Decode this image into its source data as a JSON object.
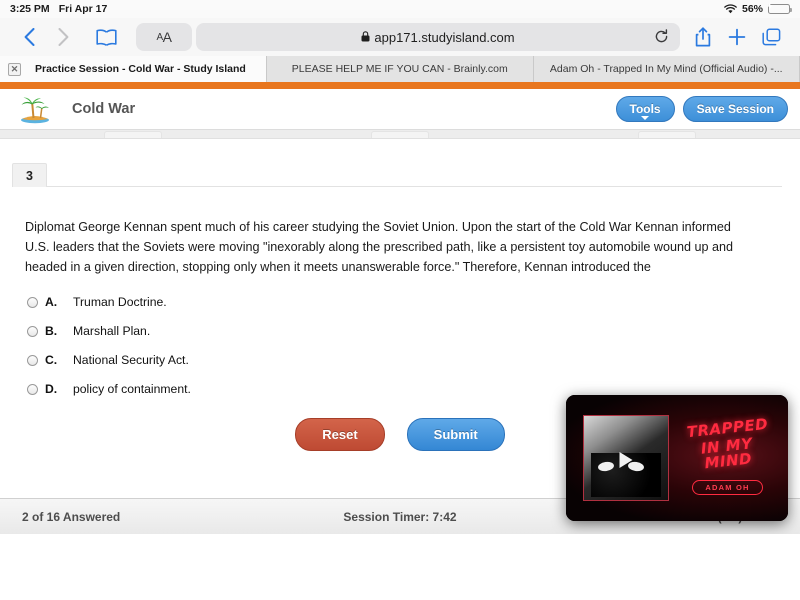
{
  "status_bar": {
    "time": "3:25 PM",
    "date": "Fri Apr 17",
    "battery_percent": "56%",
    "wifi_icon": "wifi-icon",
    "battery_icon": "battery-charging-icon"
  },
  "browser": {
    "back_icon": "chevron-left-icon",
    "forward_icon": "chevron-right-icon",
    "bookmarks_icon": "book-icon",
    "text_size_label_small": "A",
    "text_size_label_large": "A",
    "lock_icon": "lock-icon",
    "url": "app171.studyisland.com",
    "reload_icon": "reload-icon",
    "share_icon": "share-icon",
    "new_tab_icon": "plus-icon",
    "tabs_overview_icon": "tabs-icon",
    "tabs": [
      {
        "label": "Practice Session - Cold War - Study Island",
        "active": true,
        "close_icon": "close-icon"
      },
      {
        "label": "PLEASE HELP ME IF YOU CAN - Brainly.com",
        "active": false
      },
      {
        "label": "Adam Oh - Trapped In My Mind (Official Audio) -...",
        "active": false
      }
    ]
  },
  "site_header": {
    "logo_icon": "palm-island-logo",
    "title": "Cold War",
    "tools_button": "Tools",
    "save_session_button": "Save Session",
    "brand_color": "#e8761e",
    "button_color": "#3d8fd8"
  },
  "question": {
    "number": "3",
    "text": "Diplomat George Kennan spent much of his career studying the Soviet Union. Upon the start of the Cold War Kennan informed U.S. leaders that the Soviets were moving \"inexorably along the prescribed path, like a persistent toy automobile wound up and headed in a given direction, stopping only when it meets unanswerable force.\" Therefore, Kennan introduced the",
    "options": [
      {
        "letter": "A.",
        "text": "Truman Doctrine.",
        "selected": false
      },
      {
        "letter": "B.",
        "text": "Marshall Plan.",
        "selected": false
      },
      {
        "letter": "C.",
        "text": "National Security Act.",
        "selected": false
      },
      {
        "letter": "D.",
        "text": "policy of containment.",
        "selected": false
      }
    ]
  },
  "actions": {
    "reset_button": "Reset",
    "reset_color": "#be4a33",
    "submit_button": "Submit",
    "submit_color": "#3487d4"
  },
  "footer": {
    "answered": "2 of 16 Answered",
    "timer": "Session Timer: 7:42",
    "score": "Session Score: 100% (2/2)"
  },
  "pip_video": {
    "title_line1": "TRAPPED",
    "title_line2": "IN MY MIND",
    "artist": "ADAM OH",
    "play_icon": "play-icon"
  }
}
